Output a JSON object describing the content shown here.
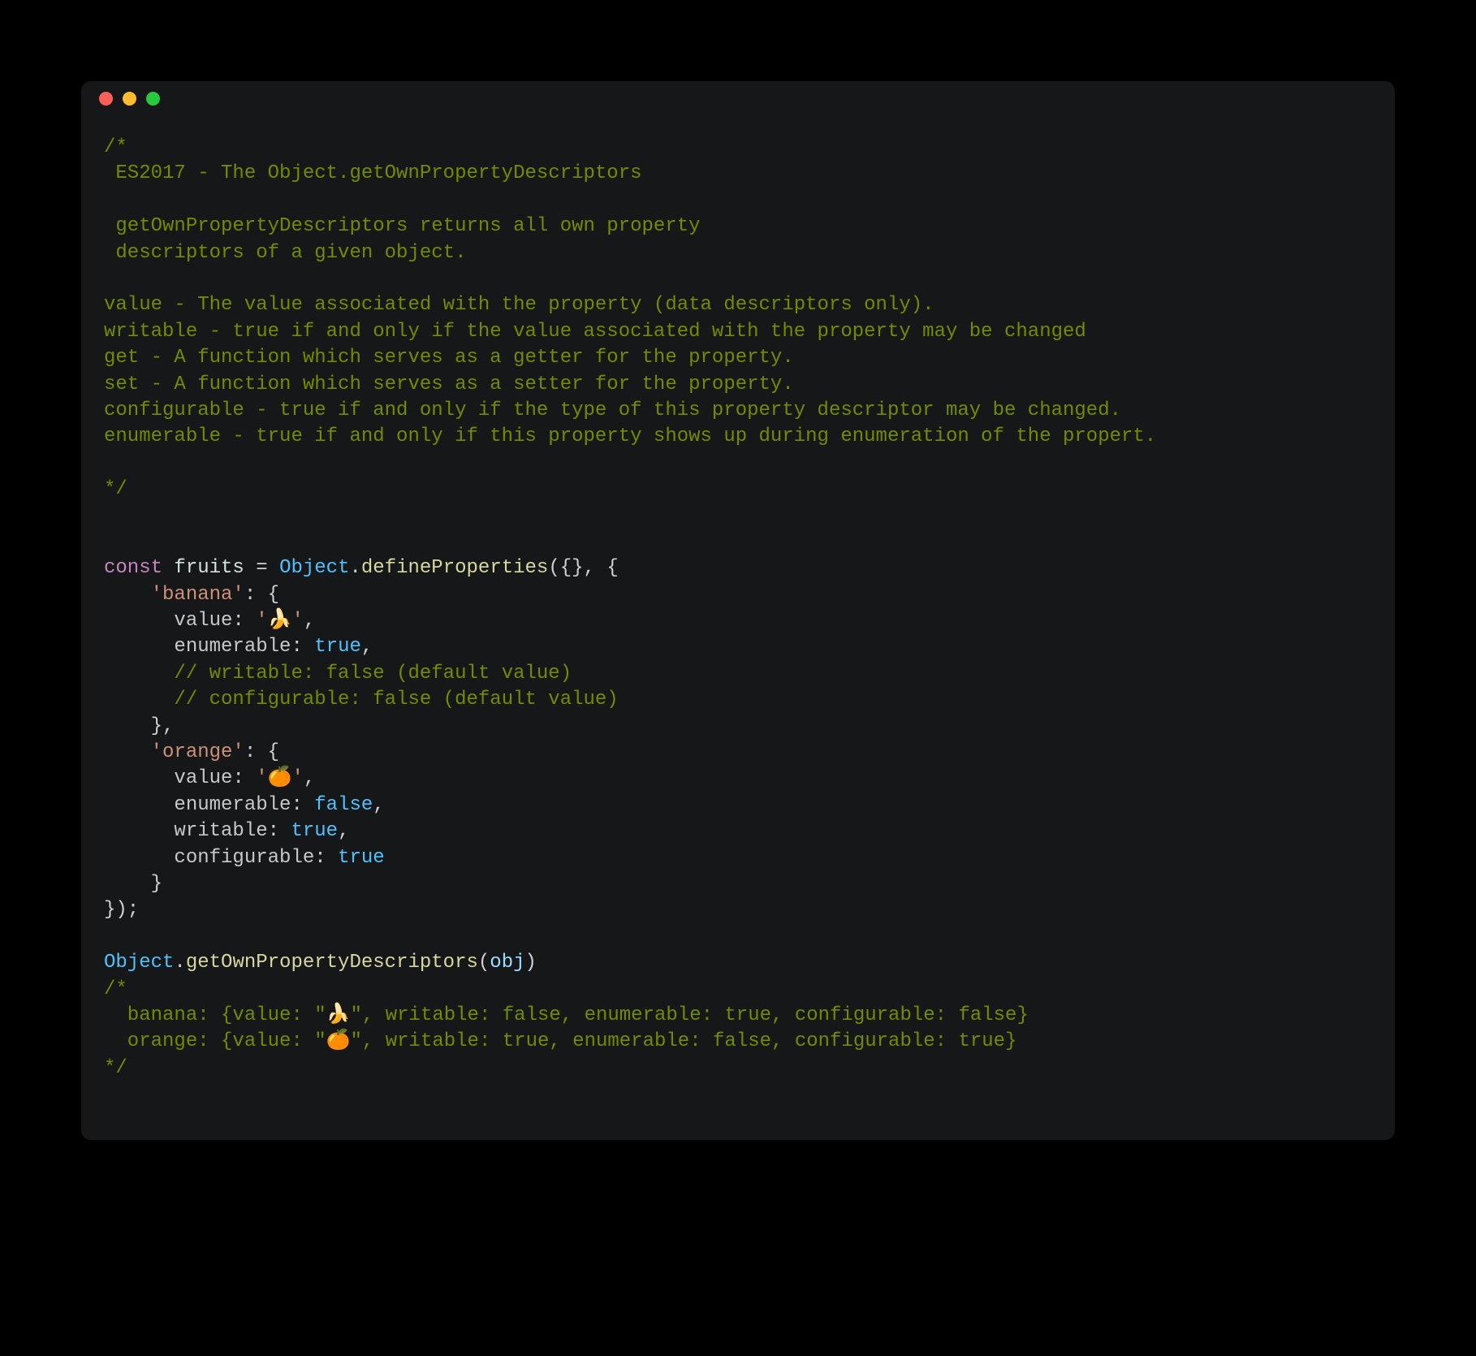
{
  "comment_block_1": {
    "l0": "/*",
    "l1": " ES2017 - The Object.getOwnPropertyDescriptors",
    "l2": "",
    "l3": " getOwnPropertyDescriptors returns all own property",
    "l4": " descriptors of a given object.",
    "l5": "",
    "l6": "value - The value associated with the property (data descriptors only).",
    "l7": "writable - true if and only if the value associated with the property may be changed",
    "l8": "get - A function which serves as a getter for the property.",
    "l9": "set - A function which serves as a setter for the property.",
    "l10": "configurable - true if and only if the type of this property descriptor may be changed.",
    "l11": "enumerable - true if and only if this property shows up during enumeration of the propert.",
    "l12": "",
    "l13": "*/"
  },
  "code": {
    "kw_const": "const",
    "ident_fruits": "fruits",
    "eq": " = ",
    "class_Object": "Object",
    "dot": ".",
    "fn_defineProperties": "defineProperties",
    "open_call": "({}, {",
    "banana_key": "'banana'",
    "colon_brace": ": {",
    "value_label": "value",
    "colon_sp": ": ",
    "banana_val": "'🍌'",
    "comma": ",",
    "enumerable_label": "enumerable",
    "true": "true",
    "false": "false",
    "writable_label": "writable",
    "configurable_label": "configurable",
    "cmt_writable_default": "// writable: false (default value)",
    "cmt_configurable_default": "// configurable: false (default value)",
    "close_brace_comma": "},",
    "orange_key": "'orange'",
    "orange_val": "'🍊'",
    "close_brace": "}",
    "close_call": "});",
    "fn_getOwnPropertyDescriptors": "getOwnPropertyDescriptors",
    "open_paren": "(",
    "param_obj": "obj",
    "close_paren": ")"
  },
  "comment_block_2": {
    "l0": "/*",
    "l1": "  banana: {value: \"🍌\", writable: false, enumerable: true, configurable: false}",
    "l2": "  orange: {value: \"🍊\", writable: true, enumerable: false, configurable: true}",
    "l3": "*/"
  }
}
